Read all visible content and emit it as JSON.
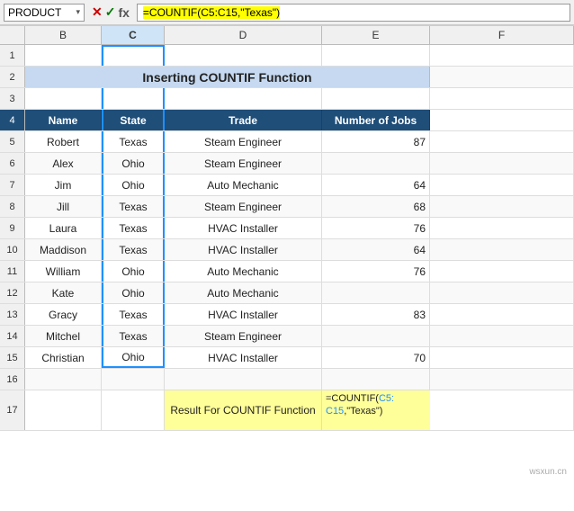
{
  "namebox": {
    "value": "PRODUCT",
    "label": "PRODUCT"
  },
  "formula": {
    "text": "=COUNTIF(C5:C15,\"Texas\")"
  },
  "title": "Inserting COUNTIF Function",
  "columns": {
    "headers": [
      "",
      "B",
      "C",
      "D",
      "E"
    ],
    "data_headers": [
      "Name",
      "State",
      "Trade",
      "Number of Jobs"
    ]
  },
  "rows": [
    {
      "row": 1,
      "name": "",
      "state": "",
      "trade": "",
      "jobs": ""
    },
    {
      "row": 2,
      "name": "",
      "state": "",
      "trade": "",
      "jobs": ""
    },
    {
      "row": 3,
      "name": "",
      "state": "",
      "trade": "",
      "jobs": ""
    },
    {
      "row": 4,
      "name": "Name",
      "state": "State",
      "trade": "Trade",
      "jobs": "Number of Jobs"
    },
    {
      "row": 5,
      "name": "Robert",
      "state": "Texas",
      "trade": "Steam Engineer",
      "jobs": "87"
    },
    {
      "row": 6,
      "name": "Alex",
      "state": "Ohio",
      "trade": "Steam Engineer",
      "jobs": ""
    },
    {
      "row": 7,
      "name": "Jim",
      "state": "Ohio",
      "trade": "Auto Mechanic",
      "jobs": "64"
    },
    {
      "row": 8,
      "name": "Jill",
      "state": "Texas",
      "trade": "Steam Engineer",
      "jobs": "68"
    },
    {
      "row": 9,
      "name": "Laura",
      "state": "Texas",
      "trade": "HVAC Installer",
      "jobs": "76"
    },
    {
      "row": 10,
      "name": "Maddison",
      "state": "Texas",
      "trade": "HVAC Installer",
      "jobs": "64"
    },
    {
      "row": 11,
      "name": "William",
      "state": "Ohio",
      "trade": "Auto Mechanic",
      "jobs": "76"
    },
    {
      "row": 12,
      "name": "Kate",
      "state": "Ohio",
      "trade": "Auto Mechanic",
      "jobs": ""
    },
    {
      "row": 13,
      "name": "Gracy",
      "state": "Texas",
      "trade": "HVAC Installer",
      "jobs": "83"
    },
    {
      "row": 14,
      "name": "Mitchel",
      "state": "Texas",
      "trade": "Steam Engineer",
      "jobs": ""
    },
    {
      "row": 15,
      "name": "Christian",
      "state": "Ohio",
      "trade": "HVAC Installer",
      "jobs": "70"
    },
    {
      "row": 16,
      "name": "",
      "state": "",
      "trade": "",
      "jobs": ""
    },
    {
      "row": 17,
      "name": "",
      "state": "",
      "trade": "Result For COUNTIF Function",
      "jobs_formula": "=COUNTIF(C5: C15,\"Texas\")"
    }
  ],
  "formula_icons": {
    "cancel": "✕",
    "confirm": "✓",
    "fx": "fx"
  },
  "watermark": "wsxun.cn"
}
